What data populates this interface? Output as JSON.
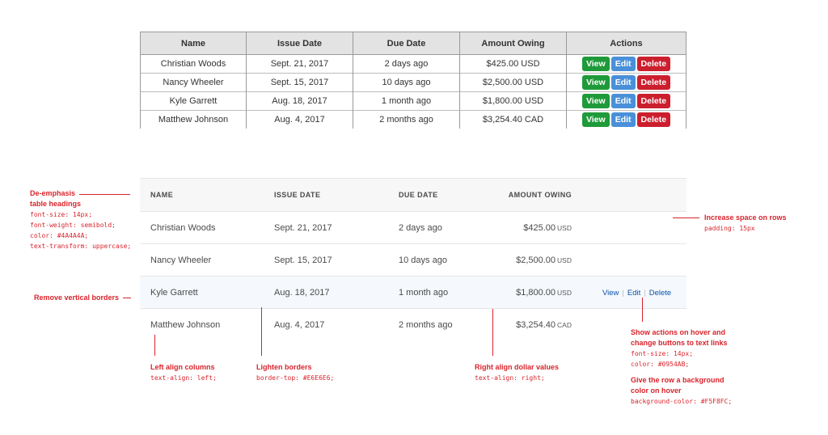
{
  "before_table": {
    "headers": [
      "Name",
      "Issue Date",
      "Due Date",
      "Amount Owing",
      "Actions"
    ],
    "rows": [
      {
        "name": "Christian Woods",
        "issue_date": "Sept. 21, 2017",
        "due_date": "2 days ago",
        "amount": "$425.00 USD"
      },
      {
        "name": "Nancy Wheeler",
        "issue_date": "Sept. 15, 2017",
        "due_date": "10 days ago",
        "amount": "$2,500.00 USD"
      },
      {
        "name": "Kyle Garrett",
        "issue_date": "Aug. 18, 2017",
        "due_date": "1 month ago",
        "amount": "$1,800.00 USD"
      },
      {
        "name": "Matthew Johnson",
        "issue_date": "Aug. 4, 2017",
        "due_date": "2 months ago",
        "amount": "$3,254.40 CAD"
      }
    ],
    "buttons": {
      "view": "View",
      "edit": "Edit",
      "delete": "Delete"
    }
  },
  "after_table": {
    "headers": [
      "NAME",
      "ISSUE DATE",
      "DUE DATE",
      "AMOUNT OWING"
    ],
    "rows": [
      {
        "name": "Christian Woods",
        "issue_date": "Sept. 21, 2017",
        "due_date": "2 days ago",
        "amount": "$425.00",
        "currency": "USD"
      },
      {
        "name": "Nancy Wheeler",
        "issue_date": "Sept. 15, 2017",
        "due_date": "10 days ago",
        "amount": "$2,500.00",
        "currency": "USD"
      },
      {
        "name": "Kyle Garrett",
        "issue_date": "Aug. 18, 2017",
        "due_date": "1 month ago",
        "amount": "$1,800.00",
        "currency": "USD"
      },
      {
        "name": "Matthew Johnson",
        "issue_date": "Aug. 4, 2017",
        "due_date": "2 months ago",
        "amount": "$3,254.40",
        "currency": "CAD"
      }
    ],
    "hover_row_actions": {
      "view": "View",
      "edit": "Edit",
      "delete": "Delete",
      "separator": "|"
    }
  },
  "annotations": {
    "deemphasis": {
      "title_line1": "De-emphasis",
      "title_line2": "table headings",
      "code": [
        "font-size: 14px;",
        "font-weight: semibold;",
        "color: #4A4A4A;",
        "text-transform: uppercase;"
      ]
    },
    "remove_borders": {
      "title": "Remove vertical borders"
    },
    "increase_space": {
      "title": "Increase space on rows",
      "code": "padding: 15px"
    },
    "left_align": {
      "title": "Left align columns",
      "code": "text-align: left;"
    },
    "lighten_borders": {
      "title": "Lighten borders",
      "code": "border-top: #E6E6E6;"
    },
    "right_align": {
      "title": "Right align dollar values",
      "code": "text-align: right;"
    },
    "show_actions": {
      "title_line1": "Show actions on hover and",
      "title_line2": "change buttons to text links",
      "code": [
        "font-size: 14px;",
        "color: #0954AB;"
      ]
    },
    "row_background": {
      "title_line1": "Give the row a background",
      "title_line2": "color on hover",
      "code": "background-color: #F5F8FC;"
    }
  },
  "colors": {
    "annotation_red": "#d8242c",
    "link_blue": "#0954AB",
    "hover_bg": "#F5F8FC",
    "border_light": "#E6E6E6",
    "btn_green": "#1f9a3a",
    "btn_blue": "#4a90d9",
    "btn_red": "#cc1f2e"
  }
}
